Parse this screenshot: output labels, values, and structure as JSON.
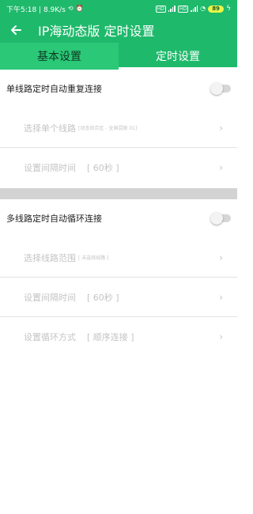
{
  "status_bar": {
    "time_speed": "下午5:18 | 8.9K/s",
    "battery": "89"
  },
  "app_bar": {
    "title": "IP海动态版 定时设置"
  },
  "tabs": [
    {
      "label": "基本设置",
      "selected": false
    },
    {
      "label": "定时设置",
      "selected": true
    }
  ],
  "single_section": {
    "toggle_label": "单线路定时自动重复连接",
    "select_line_label": "选择单个线路",
    "select_line_detail": "[动态综合区 - 全国混拨 01]",
    "interval_label": "设置间隔时间",
    "interval_value": "[ 60秒 ]"
  },
  "multi_section": {
    "toggle_label": "多线路定时自动循环连接",
    "range_label": "选择线路范围",
    "range_detail": "[ 未选择线路 ]",
    "interval_label": "设置间隔时间",
    "interval_value": "[ 60秒 ]",
    "mode_label": "设置循环方式",
    "mode_value": "[ 顺序连接 ]"
  },
  "colors": {
    "brand_green": "#1fb96b",
    "disabled_text": "#c4c4c4"
  },
  "icons": {
    "back": "arrow-left",
    "chevron": "chevron-right"
  }
}
